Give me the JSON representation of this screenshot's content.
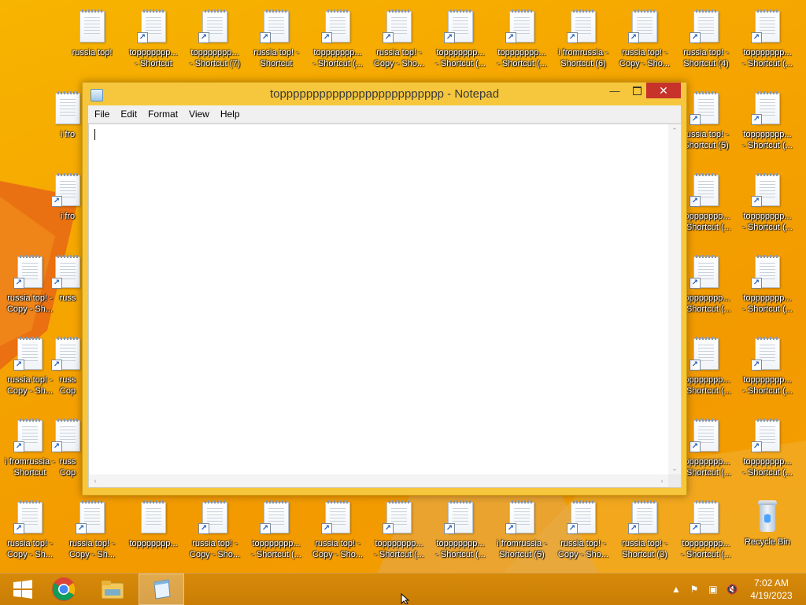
{
  "desktop": {
    "icons": [
      {
        "label": "russia top!",
        "shortcut": false
      },
      {
        "label": "toppppppp...\n- Shortcut",
        "shortcut": true
      },
      {
        "label": "toppppppp...\n- Shortcut (7)",
        "shortcut": true
      },
      {
        "label": "russia top! -\nShortcut",
        "shortcut": true
      },
      {
        "label": "toppppppp...\n- Shortcut (...",
        "shortcut": true
      },
      {
        "label": "russia top! -\nCopy - Sho...",
        "shortcut": true
      },
      {
        "label": "toppppppp...\n- Shortcut (...",
        "shortcut": true
      },
      {
        "label": "toppppppp...\n- Shortcut (...",
        "shortcut": true
      },
      {
        "label": "i fromrussia -\nShortcut (6)",
        "shortcut": true
      },
      {
        "label": "russia top! -\nCopy - Sho...",
        "shortcut": true
      },
      {
        "label": "russia top! -\nShortcut (4)",
        "shortcut": true
      },
      {
        "label": "toppppppp...\n- Shortcut (...",
        "shortcut": true
      },
      {
        "label": "i fro",
        "shortcut": false
      },
      {
        "label": "russia top! -\nShortcut (5)",
        "shortcut": true
      },
      {
        "label": "toppppppp...\n- Shortcut (...",
        "shortcut": true
      },
      {
        "label": "i fro",
        "shortcut": true
      },
      {
        "label": "toppppppp...\n- Shortcut (...",
        "shortcut": true
      },
      {
        "label": "toppppppp...\n- Shortcut (...",
        "shortcut": true
      },
      {
        "label": "russia top! -\nCopy - Sh...",
        "shortcut": true
      },
      {
        "label": "russ",
        "shortcut": true
      },
      {
        "label": "toppppppp...\n- Shortcut (...",
        "shortcut": true
      },
      {
        "label": "toppppppp...\n- Shortcut (...",
        "shortcut": true
      },
      {
        "label": "russia top! -\nCopy - Sh...",
        "shortcut": true
      },
      {
        "label": "russ\nCop",
        "shortcut": true
      },
      {
        "label": "toppppppp...\n- Shortcut (...",
        "shortcut": true
      },
      {
        "label": "toppppppp...\n- Shortcut (...",
        "shortcut": true
      },
      {
        "label": "i fromrussia -\nShortcut",
        "shortcut": true
      },
      {
        "label": "russ\nCop",
        "shortcut": true
      },
      {
        "label": "toppppppp...\n- Shortcut (...",
        "shortcut": true
      },
      {
        "label": "toppppppp...\n- Shortcut (...",
        "shortcut": true
      },
      {
        "label": "russia top! -\nCopy - Sh...",
        "shortcut": true
      },
      {
        "label": "russia top! -\nCopy - Sh...",
        "shortcut": true
      },
      {
        "label": "toppppppp...",
        "shortcut": false
      },
      {
        "label": "russia top! -\nCopy - Sho...",
        "shortcut": true
      },
      {
        "label": "toppppppp...\n- Shortcut (...",
        "shortcut": true
      },
      {
        "label": "russia top! -\nCopy - Sho...",
        "shortcut": true
      },
      {
        "label": "toppppppp...\n- Shortcut (...",
        "shortcut": true
      },
      {
        "label": "toppppppp...\n- Shortcut (...",
        "shortcut": true
      },
      {
        "label": "i fromrussia -\nShortcut (5)",
        "shortcut": true
      },
      {
        "label": "russia top! -\nCopy - Sho...",
        "shortcut": true
      },
      {
        "label": "russia top! -\nShortcut (3)",
        "shortcut": true
      },
      {
        "label": "toppppppp...\n- Shortcut (...",
        "shortcut": true
      }
    ],
    "recycle_bin_label": "Recycle Bin"
  },
  "notepad": {
    "title": "toppppppppppppppppppppppppp - Notepad",
    "menu": [
      "File",
      "Edit",
      "Format",
      "View",
      "Help"
    ],
    "content": ""
  },
  "taskbar": {
    "items": [
      "start-button",
      "chrome",
      "file-explorer",
      "notepad"
    ],
    "active_item": "notepad",
    "clock_time": "7:02 AM",
    "clock_date": "4/19/2023"
  }
}
